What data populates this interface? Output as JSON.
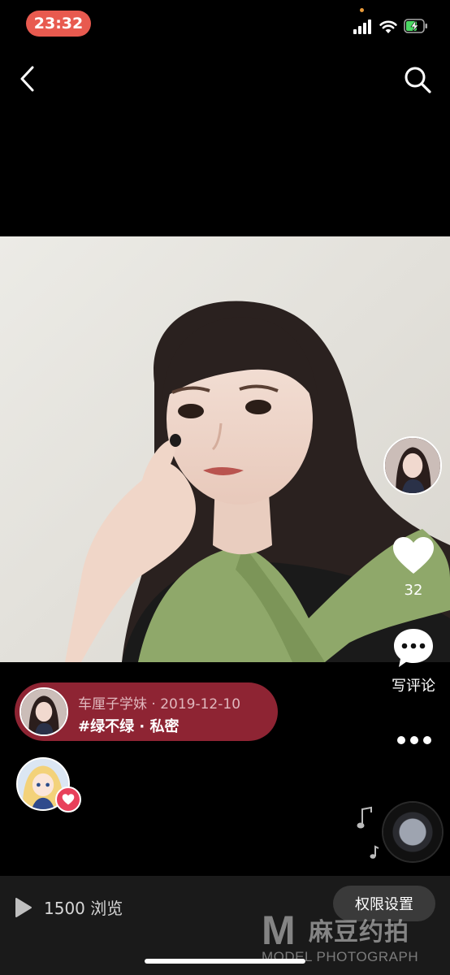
{
  "status_bar": {
    "time": "23:32",
    "icons": [
      "signal-icon",
      "wifi-icon",
      "battery-charging-icon"
    ]
  },
  "nav": {
    "icons": [
      "back-icon",
      "search-icon"
    ]
  },
  "post": {
    "like_count": "32",
    "comment_label": "写评论",
    "author_meta": "车厘子学妹 · 2019-12-10",
    "tags": "#绿不绿 · 私密",
    "views": "1500 浏览",
    "permission_button": "权限设置"
  },
  "watermark": {
    "letter": "M",
    "name_cn": "麻豆约拍",
    "name_en": "MODEL PHOTOGRAPH"
  },
  "colors": {
    "time_pill": "#e85a4f",
    "info_pill": "#8e2433",
    "heart_badge": "#e8405a",
    "bottom_bar": "#1a1a1a"
  }
}
